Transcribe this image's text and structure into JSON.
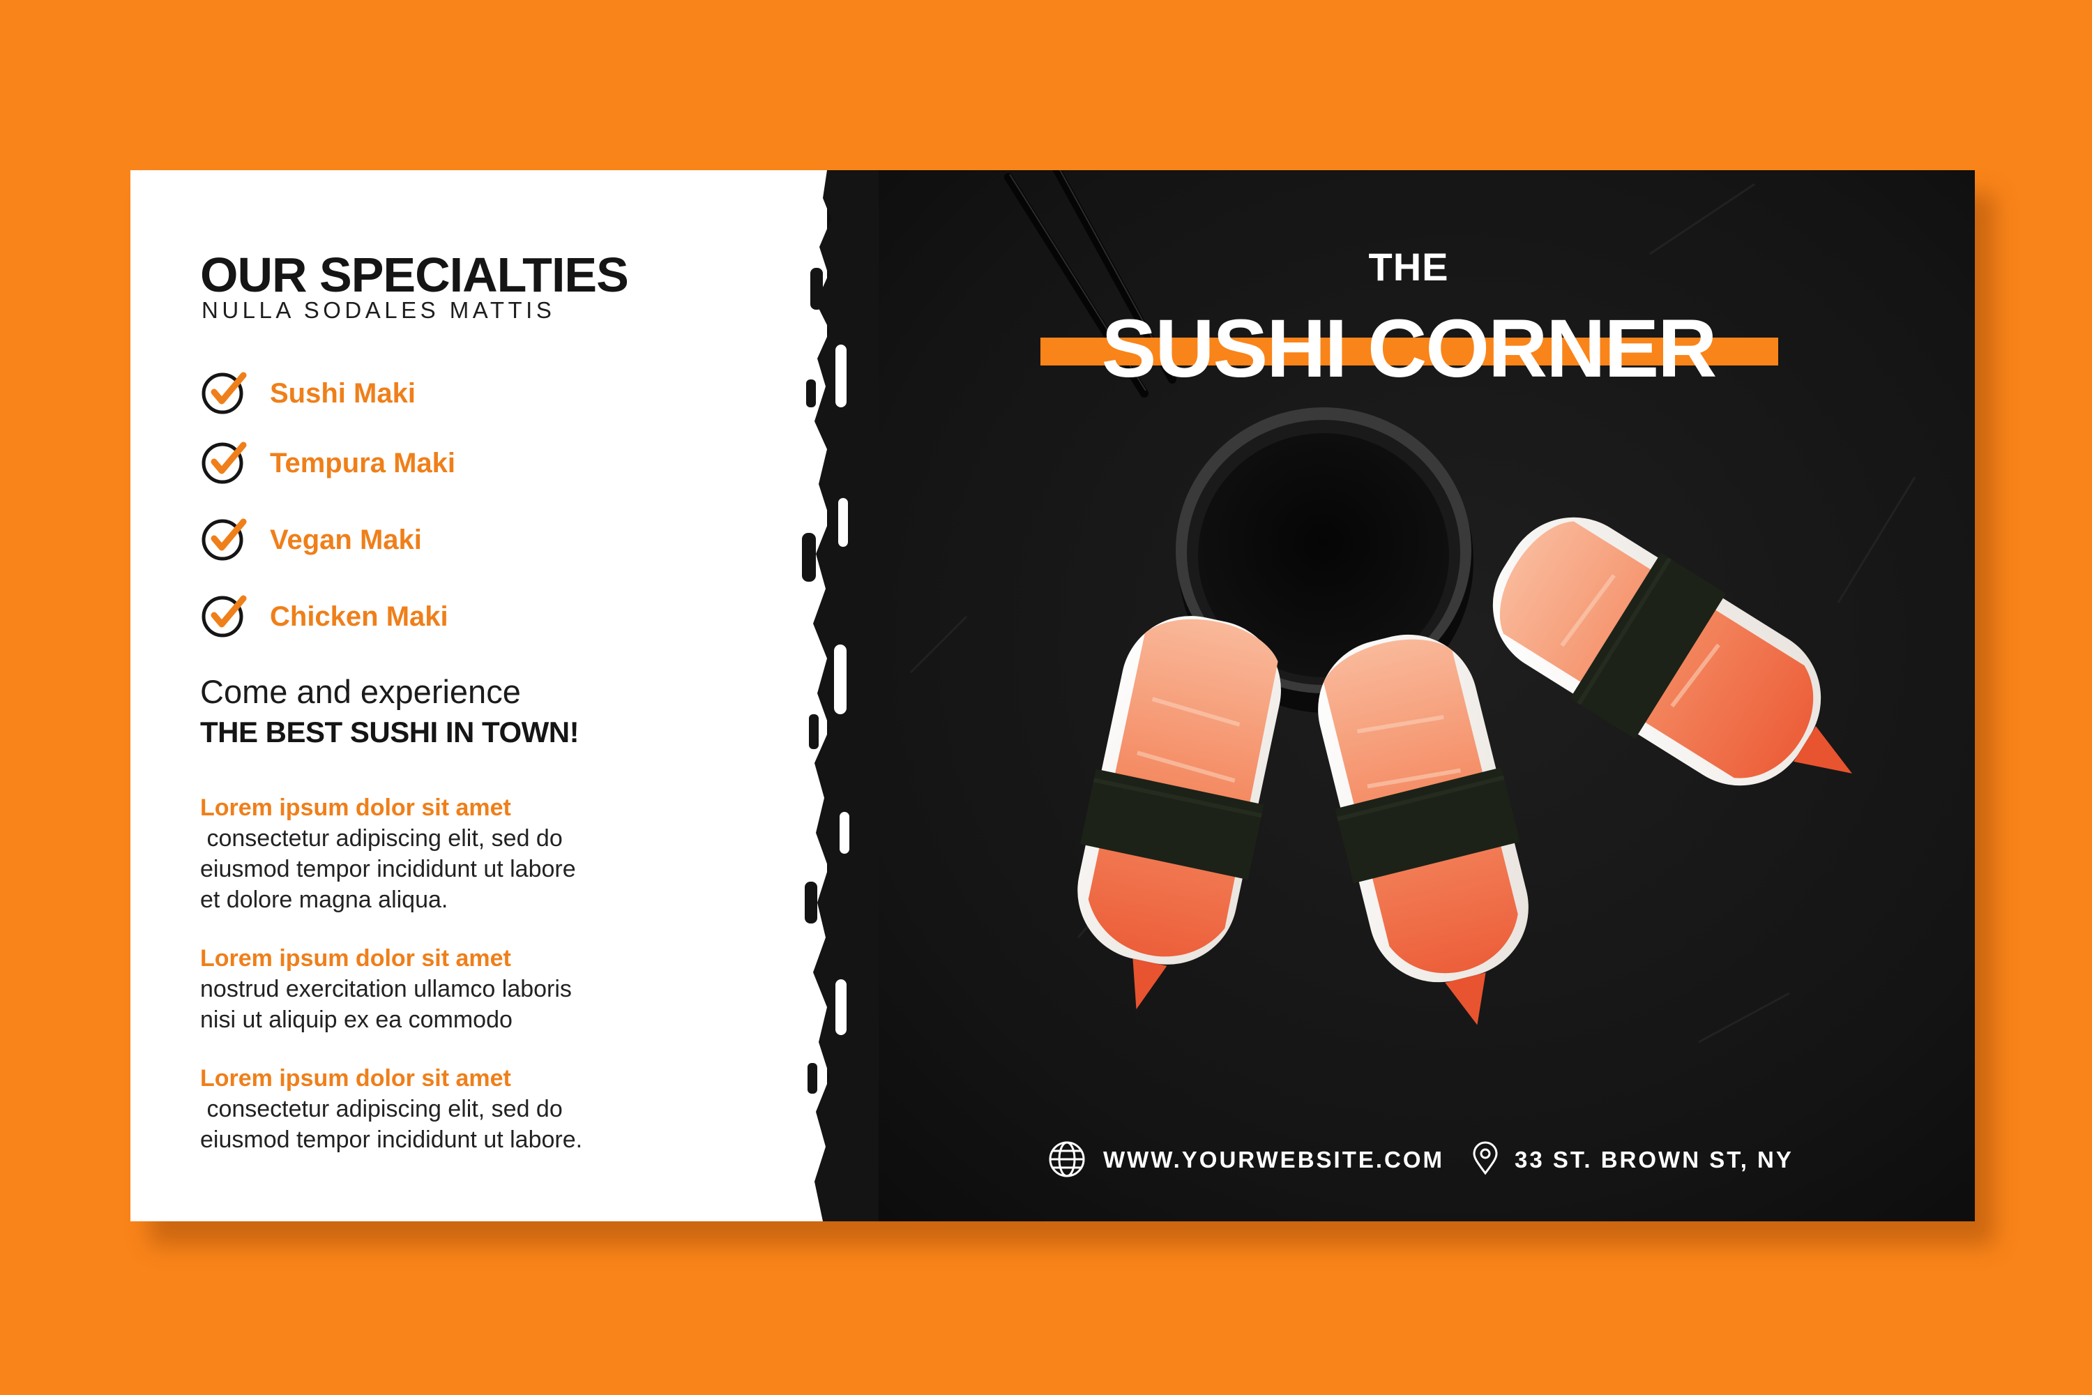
{
  "specialties": {
    "title": "OUR SPECIALTIES",
    "subtitle": "NULLA SODALES MATTIS",
    "items": [
      {
        "label": "Sushi Maki",
        "icon": "checkmark-circle-icon"
      },
      {
        "label": "Tempura Maki",
        "icon": "checkmark-circle-icon"
      },
      {
        "label": "Vegan Maki",
        "icon": "checkmark-circle-icon"
      },
      {
        "label": "Chicken Maki",
        "icon": "checkmark-circle-icon"
      }
    ]
  },
  "tagline": {
    "line1": "Come and experience",
    "line2": "THE BEST SUSHI IN TOWN!"
  },
  "paragraphs": [
    {
      "heading": "Lorem ipsum dolor sit amet",
      "lines": [
        " consectetur adipiscing elit, sed do",
        "eiusmod tempor incididunt ut labore",
        "et dolore magna aliqua."
      ]
    },
    {
      "heading": "Lorem ipsum dolor sit amet",
      "lines": [
        "nostrud exercitation ullamco laboris",
        "nisi ut aliquip ex ea commodo"
      ]
    },
    {
      "heading": "Lorem ipsum dolor sit amet",
      "lines": [
        " consectetur adipiscing elit, sed do",
        "eiusmod tempor incididunt ut labore."
      ]
    }
  ],
  "brand": {
    "pre_title": "THE",
    "title": "SUSHI CORNER"
  },
  "contact": {
    "website": "WWW.YOURWEBSITE.COM",
    "address": "33 ST. BROWN ST, NY",
    "website_icon": "globe-icon",
    "address_icon": "location-pin-icon"
  },
  "colors": {
    "accent": "#f98419",
    "accent_text": "#ef7f1a",
    "dark_background": "#141414",
    "card": "#ffffff"
  }
}
